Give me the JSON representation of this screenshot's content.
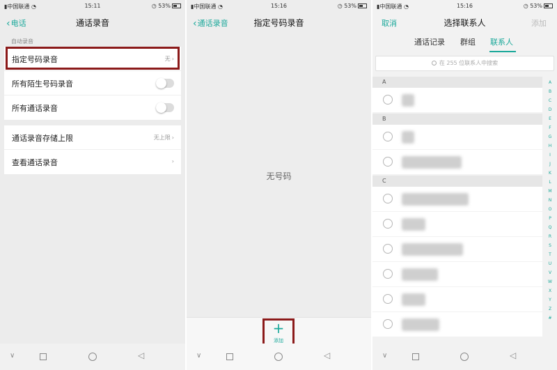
{
  "status": {
    "carrier": "中国联通",
    "battery": "53%",
    "times": [
      "15:11",
      "15:16",
      "15:16"
    ]
  },
  "screen1": {
    "back_label": "电话",
    "title": "通话录音",
    "section_label": "自动录音",
    "rows": [
      {
        "label": "指定号码录音",
        "value": "无"
      },
      {
        "label": "所有陌生号码录音"
      },
      {
        "label": "所有通话录音"
      }
    ],
    "rows2": [
      {
        "label": "通话录音存储上限",
        "value": "无上限"
      },
      {
        "label": "查看通话录音"
      }
    ]
  },
  "screen2": {
    "back_label": "通话录音",
    "title": "指定号码录音",
    "empty_text": "无号码",
    "add_label": "添加"
  },
  "screen3": {
    "cancel_label": "取消",
    "title": "选择联系人",
    "add_label": "添加",
    "tabs": [
      "通话记录",
      "群组",
      "联系人"
    ],
    "active_tab": "联系人",
    "search_placeholder": "在 255 位联系人中搜索",
    "sections": [
      "A",
      "B",
      "C"
    ],
    "alphabet": [
      "A",
      "B",
      "C",
      "D",
      "E",
      "F",
      "G",
      "H",
      "I",
      "J",
      "K",
      "L",
      "M",
      "N",
      "O",
      "P",
      "Q",
      "R",
      "S",
      "T",
      "U",
      "V",
      "W",
      "X",
      "Y",
      "Z",
      "#"
    ]
  },
  "colors": {
    "accent": "#1aa89a",
    "highlight_box": "#8b1a1a"
  }
}
